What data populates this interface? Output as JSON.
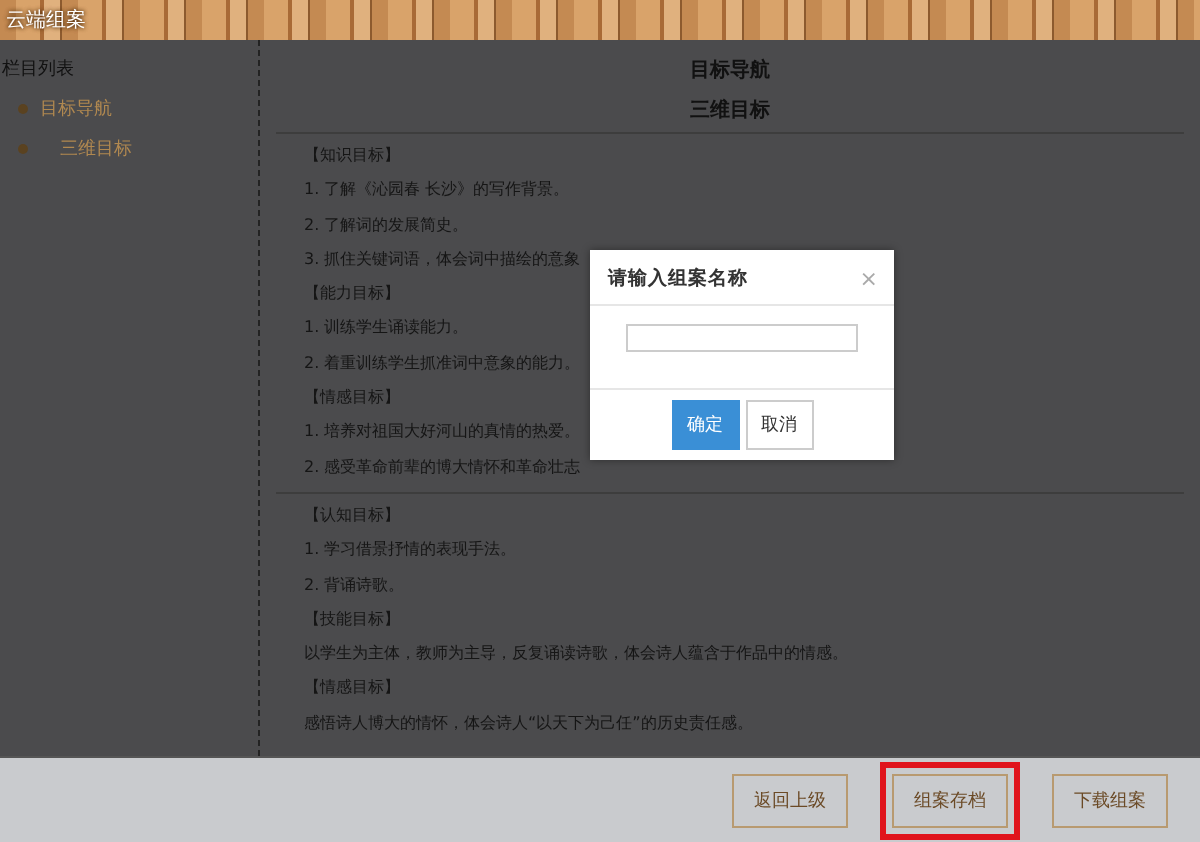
{
  "window": {
    "title": "云端组案"
  },
  "sidebar": {
    "title": "栏目列表",
    "items": [
      {
        "label": "目标导航",
        "selected": false
      },
      {
        "label": "三维目标",
        "selected": false
      }
    ]
  },
  "content": {
    "title": "目标导航",
    "subtitle": "三维目标",
    "groups": [
      {
        "sections": [
          {
            "heading": "【知识目标】",
            "lines": [
              "1. 了解《沁园春 长沙》的写作背景。",
              "2. 了解词的发展简史。",
              "3. 抓住关键词语，体会词中描绘的意象"
            ]
          },
          {
            "heading": "【能力目标】",
            "lines": [
              "1. 训练学生诵读能力。",
              "2. 着重训练学生抓准词中意象的能力。"
            ]
          },
          {
            "heading": "【情感目标】",
            "lines": [
              "1. 培养对祖国大好河山的真情的热爱。",
              "2. 感受革命前辈的博大情怀和革命壮志"
            ]
          }
        ]
      },
      {
        "sections": [
          {
            "heading": "【认知目标】",
            "lines": [
              "1. 学习借景抒情的表现手法。",
              "2. 背诵诗歌。"
            ]
          },
          {
            "heading": "【技能目标】",
            "lines": [
              "以学生为主体，教师为主导，反复诵读诗歌，体会诗人蕴含于作品中的情感。"
            ]
          },
          {
            "heading": "【情感目标】",
            "lines": [
              "感悟诗人博大的情怀，体会诗人“以天下为己任”的历史责任感。"
            ]
          }
        ]
      }
    ]
  },
  "dialog": {
    "title": "请输入组案名称",
    "close": "×",
    "buttons": [
      {
        "label": "确定",
        "kind": "primary"
      },
      {
        "label": "取消",
        "kind": "secondary"
      }
    ]
  },
  "footer": {
    "buttons": [
      {
        "label": "返回上级",
        "highlighted": false
      },
      {
        "label": "组案存档",
        "highlighted": true
      },
      {
        "label": "下载组案",
        "highlighted": false
      }
    ]
  }
}
